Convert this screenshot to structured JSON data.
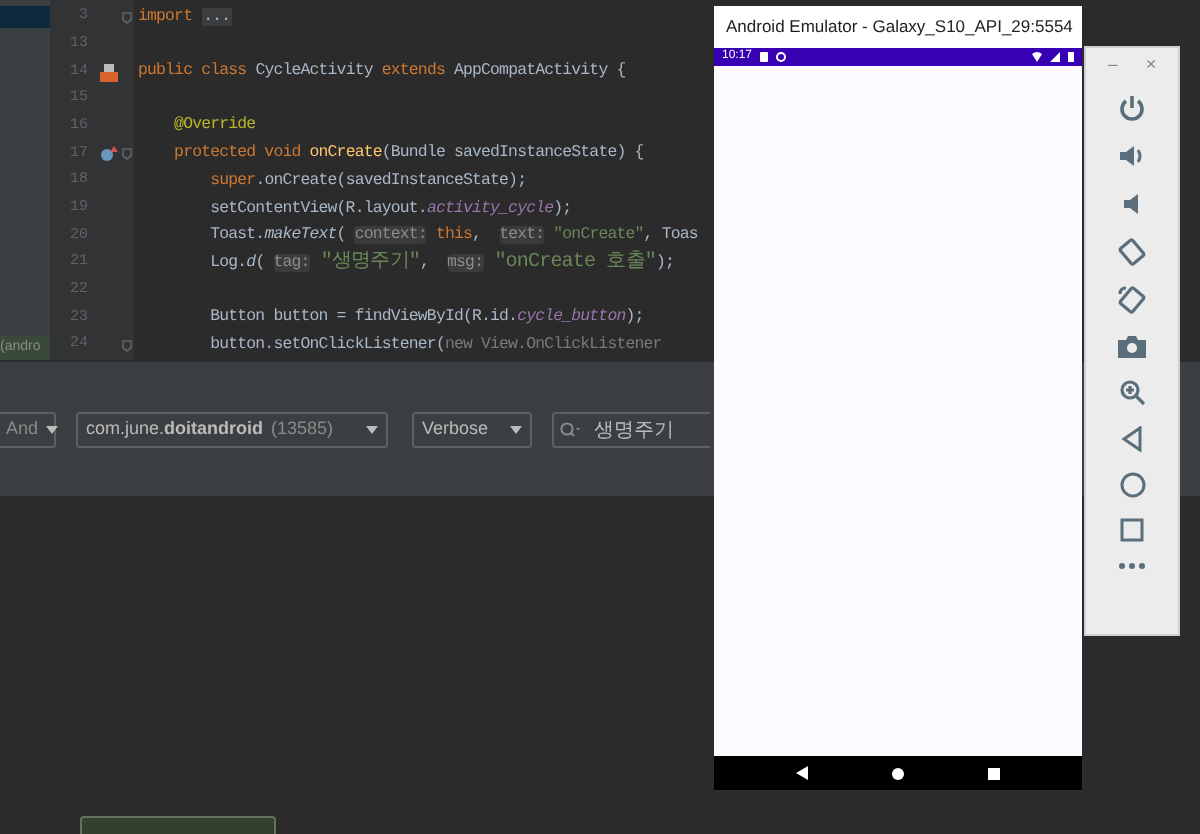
{
  "project_tree": {
    "item_label": "(andro"
  },
  "editor": {
    "lines": [
      {
        "number": "3",
        "fold": true,
        "kind": "code",
        "tokens": [
          {
            "text": "import ",
            "kind": "keyword"
          },
          {
            "text": "...",
            "kind": "folded"
          }
        ]
      },
      {
        "number": "13",
        "fold": false,
        "kind": "code"
      },
      {
        "number": "14",
        "fold": false,
        "kind": "class",
        "tokens": [
          {
            "text": "public class ",
            "kind": "keyword"
          },
          {
            "text": "CycleActivity ",
            "kind": "plain"
          },
          {
            "text": "extends ",
            "kind": "keyword"
          },
          {
            "text": "AppCompatActivity {",
            "kind": "plain"
          }
        ]
      },
      {
        "number": "15",
        "fold": false,
        "kind": "code"
      },
      {
        "number": "16",
        "fold": false,
        "kind": "code",
        "tokens": [
          {
            "text": "    @Override",
            "kind": "annotation"
          }
        ]
      },
      {
        "number": "17",
        "fold": true,
        "kind": "override",
        "tokens": [
          {
            "text": "    protected void ",
            "kind": "keyword"
          },
          {
            "text": "onCreate",
            "kind": "method"
          },
          {
            "text": "(Bundle savedInstanceState) {",
            "kind": "plain"
          }
        ]
      },
      {
        "number": "18",
        "fold": false,
        "kind": "code",
        "tokens": [
          {
            "text": "        super",
            "kind": "keyword"
          },
          {
            "text": ".onCreate(savedInstanceState);",
            "kind": "plain"
          }
        ]
      },
      {
        "number": "19",
        "fold": false,
        "kind": "code",
        "tokens": [
          {
            "text": "        setContentView(R.layout.",
            "kind": "plain"
          },
          {
            "text": "activity_cycle",
            "kind": "field"
          },
          {
            "text": ");",
            "kind": "plain"
          }
        ]
      },
      {
        "number": "20",
        "fold": false,
        "kind": "code",
        "tokens": [
          {
            "text": "        Toast.",
            "kind": "plain"
          },
          {
            "text": "makeText",
            "kind": "static"
          },
          {
            "text": "( ",
            "kind": "plain"
          },
          {
            "text": "context:",
            "kind": "hint"
          },
          {
            "text": " this",
            "kind": "keyword"
          },
          {
            "text": ",  ",
            "kind": "plain"
          },
          {
            "text": "text:",
            "kind": "hint"
          },
          {
            "text": " \"onCreate\"",
            "kind": "string"
          },
          {
            "text": ", Toas",
            "kind": "plain"
          }
        ]
      },
      {
        "number": "21",
        "fold": false,
        "kind": "code",
        "tokens": [
          {
            "text": "        Log.",
            "kind": "plain"
          },
          {
            "text": "d",
            "kind": "static"
          },
          {
            "text": "( ",
            "kind": "plain"
          },
          {
            "text": "tag:",
            "kind": "hint"
          },
          {
            "text": " \"생명주기\"",
            "kind": "string"
          },
          {
            "text": ",  ",
            "kind": "plain"
          },
          {
            "text": "msg:",
            "kind": "hint"
          },
          {
            "text": " \"onCreate 호출\"",
            "kind": "string"
          },
          {
            "text": ");",
            "kind": "plain"
          }
        ]
      },
      {
        "number": "22",
        "fold": false,
        "kind": "code"
      },
      {
        "number": "23",
        "fold": false,
        "kind": "code",
        "tokens": [
          {
            "text": "        Button button = findViewById(R.id.",
            "kind": "plain"
          },
          {
            "text": "cycle_button",
            "kind": "field"
          },
          {
            "text": ");",
            "kind": "plain"
          }
        ]
      },
      {
        "number": "24",
        "fold": true,
        "kind": "code",
        "tokens": [
          {
            "text": "        button.setOnClickListener(",
            "kind": "plain"
          },
          {
            "text": "new View.OnClickListener",
            "kind": "folded-text"
          }
        ]
      }
    ]
  },
  "logcat": {
    "device": "And",
    "process": {
      "name": "com.june.**doitandroid**",
      "pid": "(13585)"
    },
    "level": "Verbose",
    "search": {
      "value": "생명주기"
    }
  },
  "emulator": {
    "title": "Android Emulator - Galaxy_S10_API_29:5554",
    "time": "10:17",
    "minimize": "–",
    "close": "×"
  }
}
